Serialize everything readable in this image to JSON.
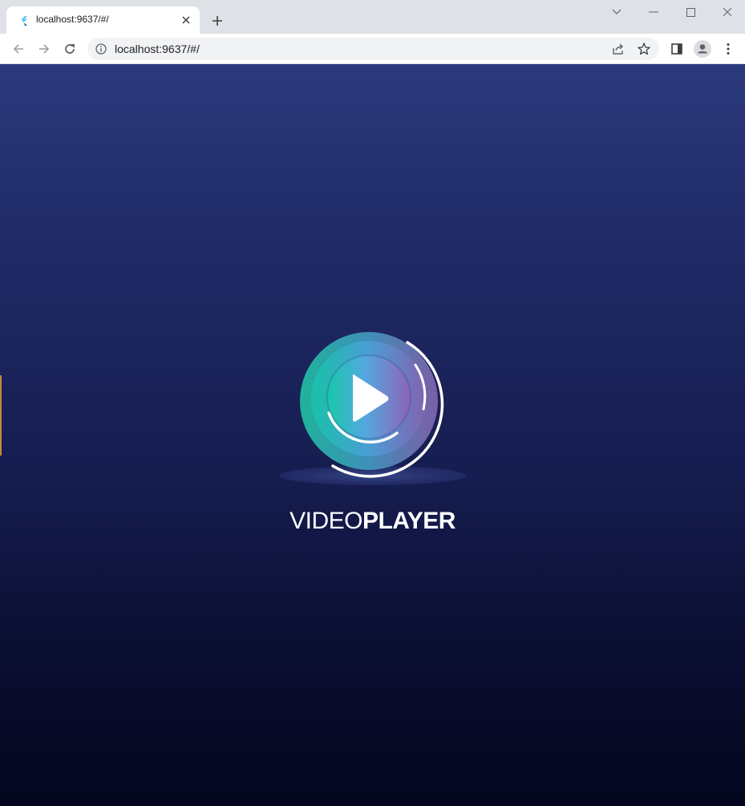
{
  "browser": {
    "tab": {
      "title": "localhost:9637/#/",
      "favicon": "flutter-icon"
    },
    "address": {
      "url": "localhost:9637/#/"
    },
    "icons": {
      "back": "arrow-left-icon",
      "forward": "arrow-right-icon",
      "reload": "reload-icon",
      "info": "info-icon",
      "share": "share-icon",
      "bookmark": "star-icon",
      "side_panel": "side-panel-icon",
      "profile": "profile-icon",
      "menu": "kebab-menu-icon",
      "new_tab": "plus-icon",
      "tab_close": "close-icon",
      "tab_search": "chevron-down-icon",
      "minimize": "minimize-icon",
      "maximize": "maximize-icon",
      "close_window": "close-icon"
    }
  },
  "app": {
    "logo": "play-button-logo-icon",
    "brand_light": "VIDEO",
    "brand_bold": "PLAYER",
    "colors": {
      "background_top": "#2b3a7d",
      "background_bottom": "#03061d",
      "logo_teal": "#14b8a6",
      "logo_purple": "#7b5ea7",
      "text": "#ffffff"
    }
  }
}
